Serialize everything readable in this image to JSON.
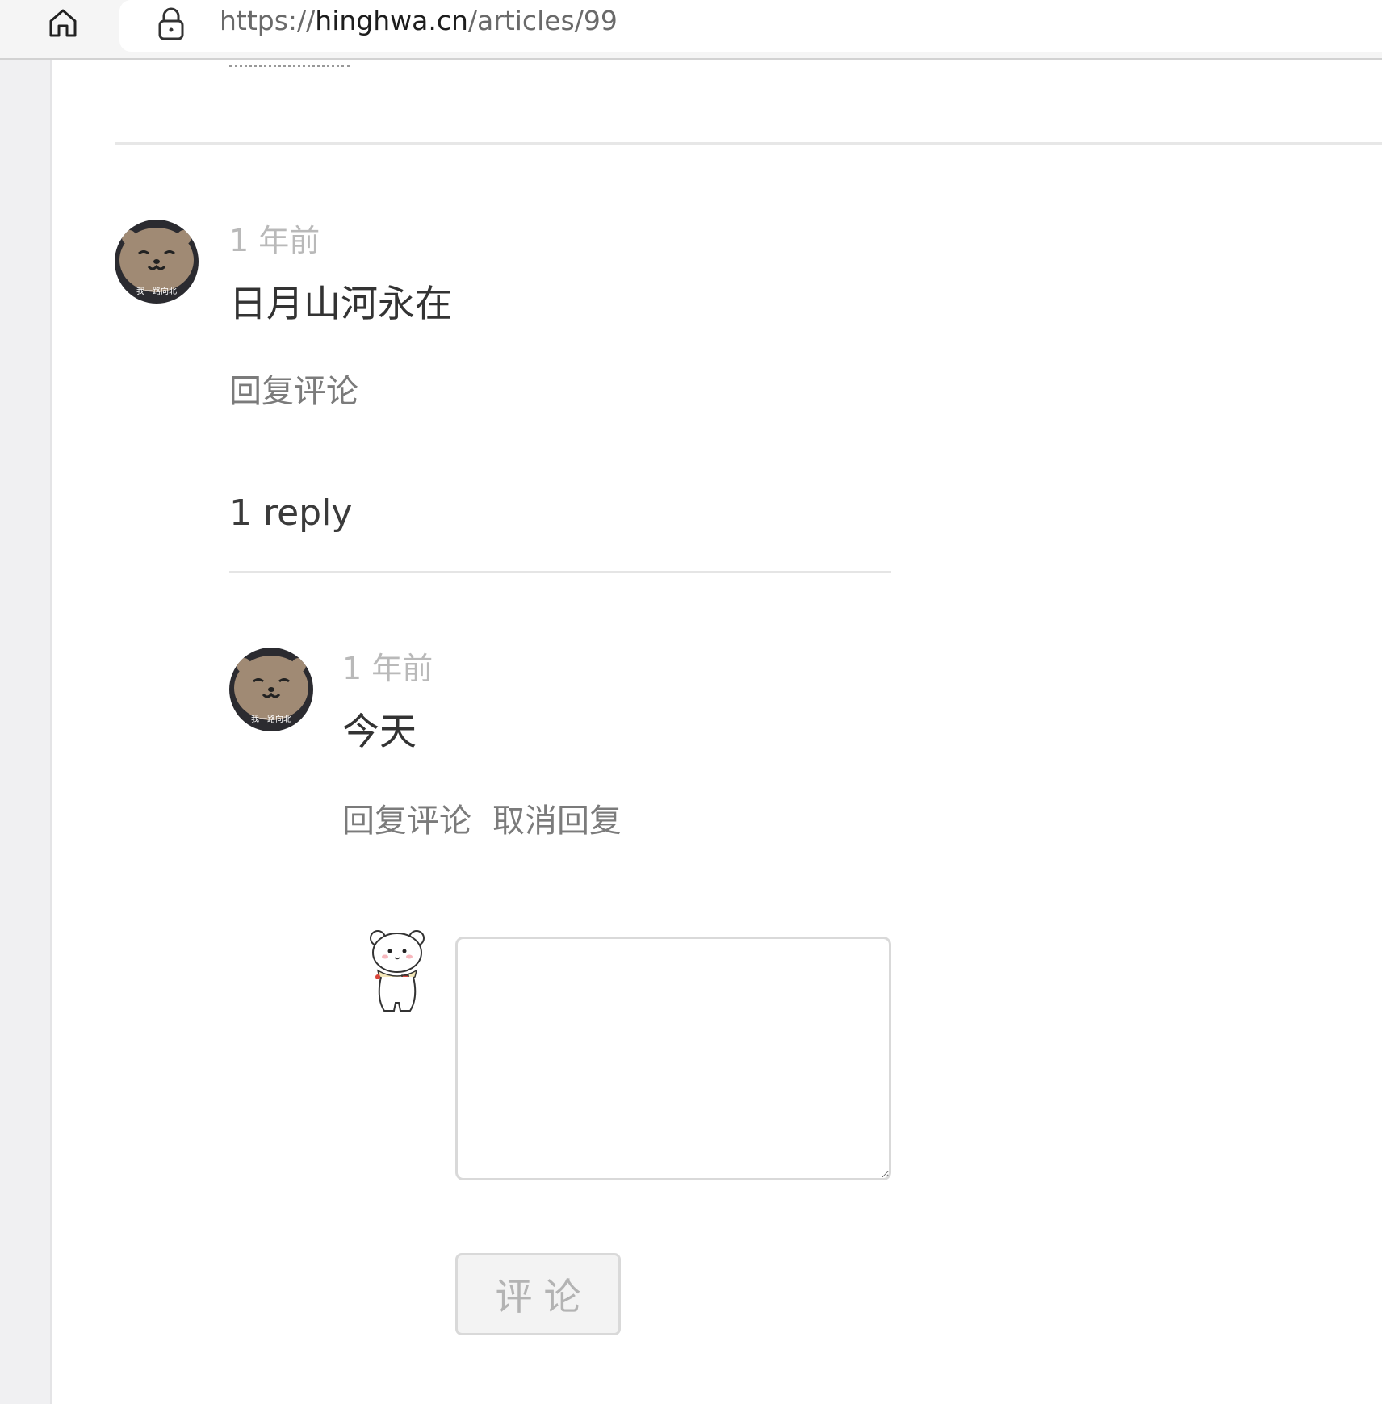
{
  "browser": {
    "url_scheme": "https://",
    "url_host": "hinghwa.cn",
    "url_path": "/articles/99"
  },
  "comments": [
    {
      "time": "1 年前",
      "body": "日月山河永在",
      "actions": {
        "reply": "回复评论"
      },
      "reply_count_label": "1 reply",
      "replies": [
        {
          "time": "1 年前",
          "body": "今天",
          "actions": {
            "reply": "回复评论",
            "cancel": "取消回复"
          }
        }
      ]
    }
  ],
  "reply_form": {
    "textarea_value": "",
    "submit_label": "评论"
  },
  "avatar": {
    "caption": "我一路向北"
  },
  "colors": {
    "time_text": "#b9b9b9",
    "action_text": "#7b7b7b",
    "body_text": "#333333"
  }
}
